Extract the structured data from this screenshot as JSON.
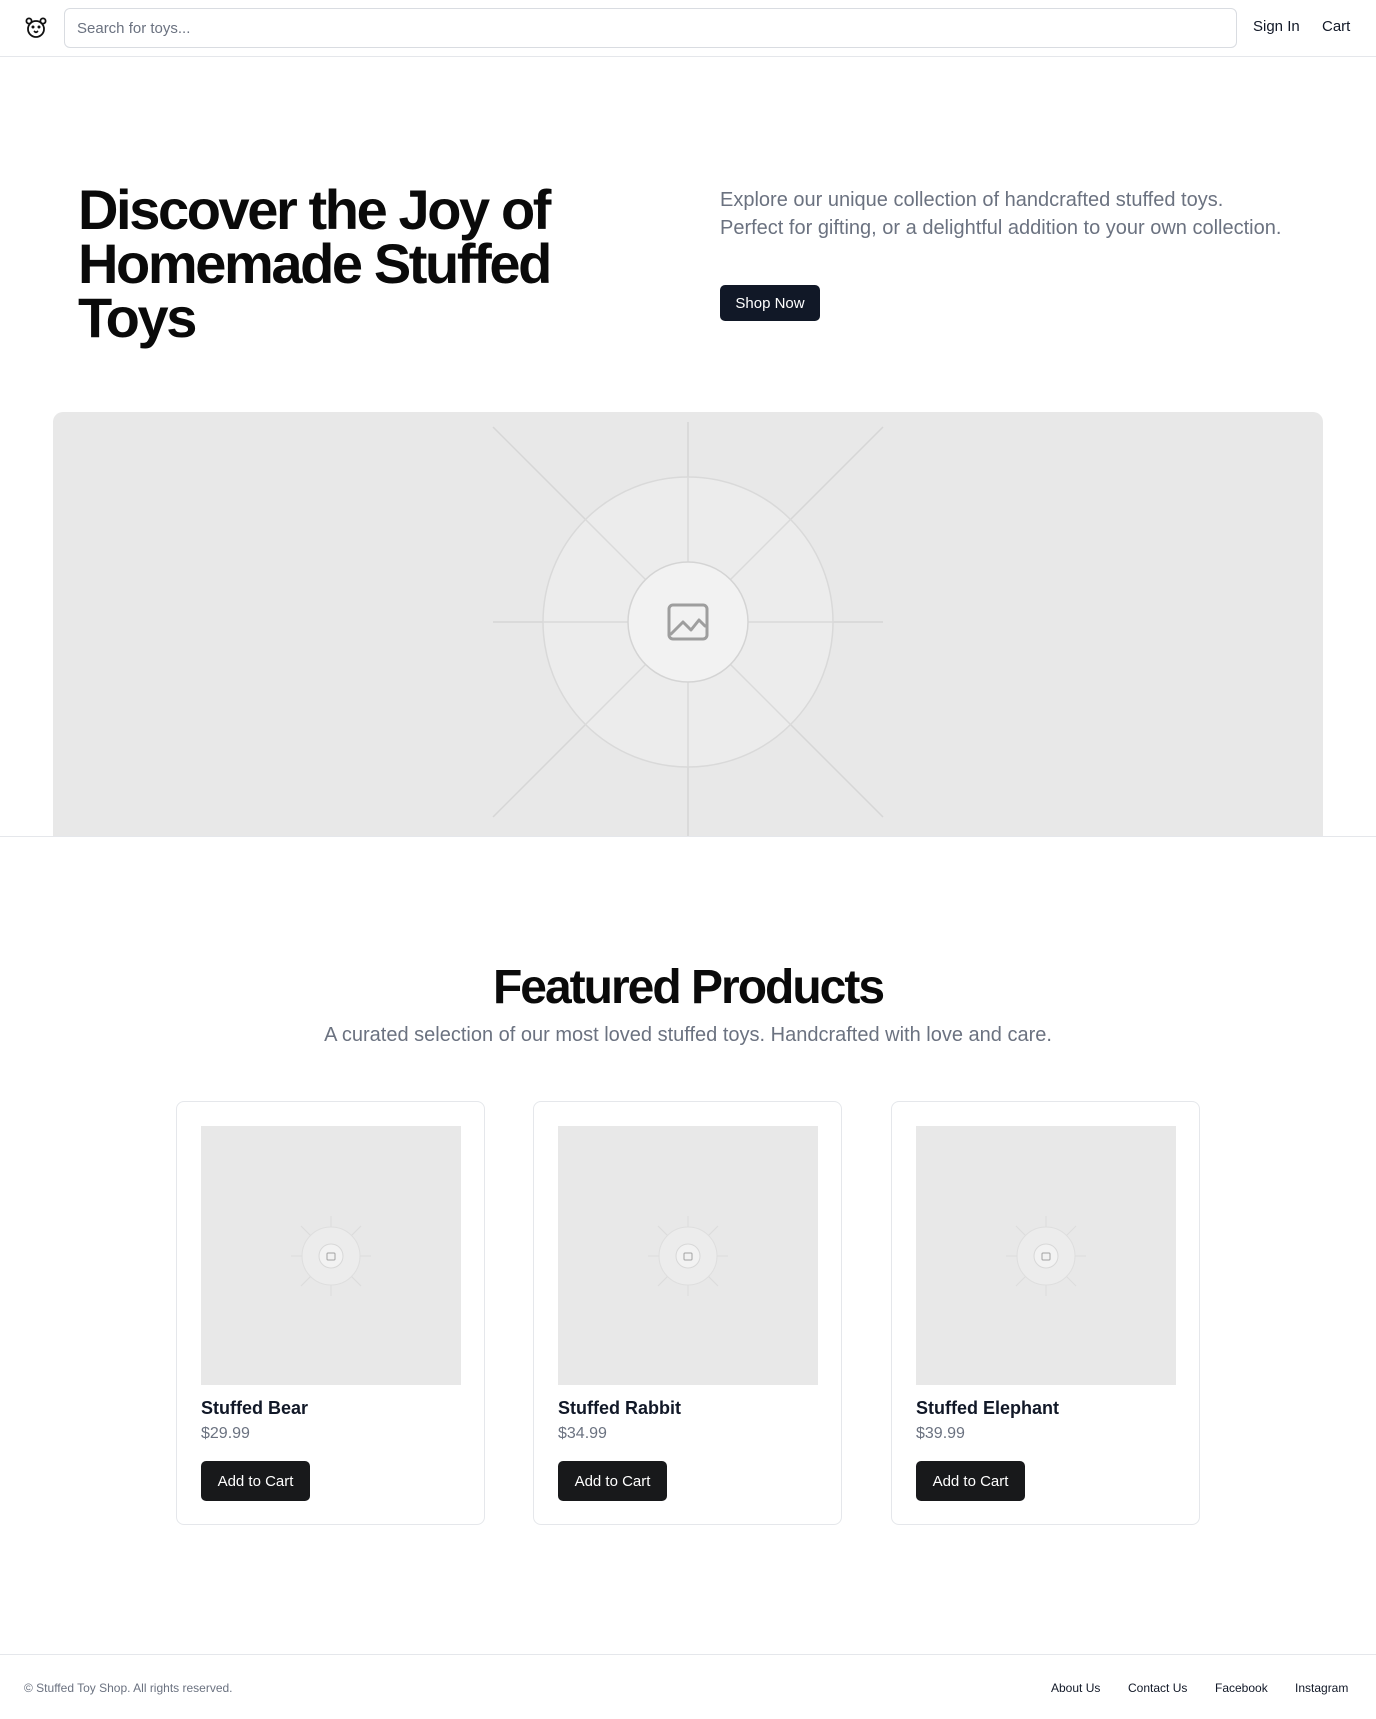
{
  "header": {
    "logo_icon": "bear-face-icon",
    "search_placeholder": "Search for toys...",
    "sign_in": "Sign In",
    "cart": "Cart"
  },
  "hero": {
    "title": "Discover the Joy of Homemade Stuffed Toys",
    "description": "Explore our unique collection of handcrafted stuffed toys. Perfect for gifting, or a delightful addition to your own collection.",
    "cta": "Shop Now",
    "image_icon": "image-placeholder-icon"
  },
  "featured": {
    "title": "Featured Products",
    "subtitle": "A curated selection of our most loved stuffed toys. Handcrafted with love and care.",
    "products": [
      {
        "name": "Stuffed Bear",
        "price": "$29.99",
        "button": "Add to Cart"
      },
      {
        "name": "Stuffed Rabbit",
        "price": "$34.99",
        "button": "Add to Cart"
      },
      {
        "name": "Stuffed Elephant",
        "price": "$39.99",
        "button": "Add to Cart"
      }
    ]
  },
  "footer": {
    "copyright": "© Stuffed Toy Shop. All rights reserved.",
    "links": [
      "About Us",
      "Contact Us",
      "Facebook",
      "Instagram"
    ]
  },
  "colors": {
    "primary_button": "#111827",
    "muted_text": "#6b7280",
    "placeholder_bg": "#e8e8e8"
  }
}
